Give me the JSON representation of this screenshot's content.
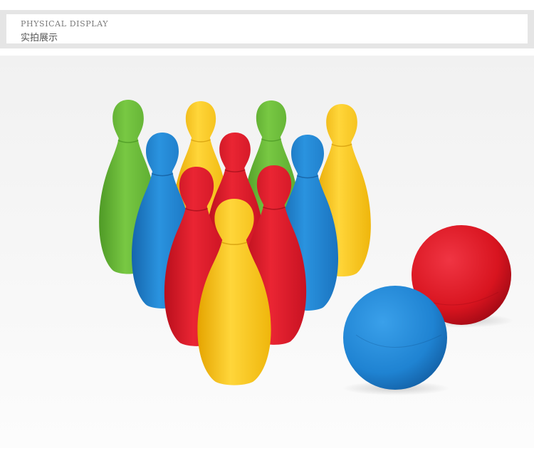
{
  "header": {
    "title_en": "PHYSICAL DISPLAY",
    "title_cn": "实拍展示"
  },
  "photo": {
    "subject_icon": "bowling-set-icon",
    "colors": {
      "green": "#6cbf3c",
      "yellow": "#f7c81e",
      "red": "#e0182a",
      "blue": "#1e86d6",
      "background_top": "#f2f2f2",
      "background_bottom": "#fbfbfb"
    }
  }
}
